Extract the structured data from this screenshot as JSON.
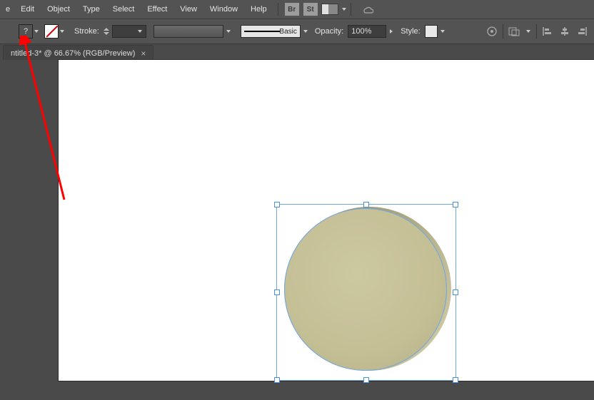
{
  "menu": {
    "file_trunc": "e",
    "edit": "Edit",
    "object": "Object",
    "type": "Type",
    "select": "Select",
    "effect": "Effect",
    "view": "View",
    "window": "Window",
    "help": "Help",
    "bridge_label": "Br",
    "stock_label": "St"
  },
  "control": {
    "stroke_label": "Stroke:",
    "brush_label": "Basic",
    "opacity_label": "Opacity:",
    "opacity_value": "100%",
    "style_label": "Style:"
  },
  "tab": {
    "title": "ntitled-3* @ 66.67% (RGB/Preview)",
    "close_glyph": "×"
  },
  "canvas": {
    "selection": {
      "shape": "cylinder-3d",
      "fill_color": "#c4bf95",
      "side_color": "#a8a27c"
    }
  },
  "annotation": {
    "type": "arrow",
    "color": "#ff0000"
  }
}
